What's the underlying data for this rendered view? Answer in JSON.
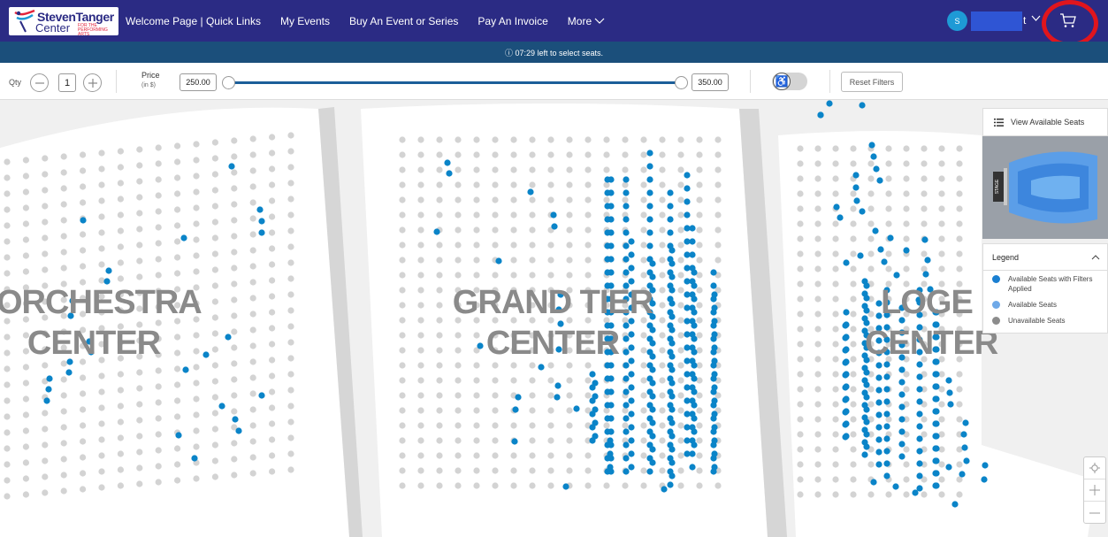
{
  "brand": {
    "line1": "StevenTanger",
    "line2": "Center",
    "tagline": "FOR THE PERFORMING ARTS"
  },
  "nav": {
    "items": [
      {
        "label": "Welcome Page | Quick Links"
      },
      {
        "label": "My Events"
      },
      {
        "label": "Buy An Event or Series"
      },
      {
        "label": "Pay An Invoice"
      },
      {
        "label": "More"
      }
    ]
  },
  "user": {
    "avatar_initial": "S",
    "name_suffix": "t"
  },
  "timer": {
    "text": "ⓘ 07:29 left to select seats."
  },
  "filters": {
    "qty_label": "Qty",
    "qty_value": "1",
    "price_label": "Price",
    "price_unit": "(in $)",
    "price_min": "250.00",
    "price_max": "350.00",
    "reset_label": "Reset Filters"
  },
  "map": {
    "sections": [
      {
        "label": "ORCHESTRA CENTER"
      },
      {
        "label": "GRAND TIER CENTER"
      },
      {
        "label": "LOGE CENTER"
      }
    ],
    "view_available_label": "View Available Seats",
    "stage_label": "STAGE"
  },
  "legend": {
    "title": "Legend",
    "items": [
      {
        "label": "Available Seats with Filters Applied",
        "color": "#1a7fd1"
      },
      {
        "label": "Available Seats",
        "color": "#6fa9e8"
      },
      {
        "label": "Unavailable Seats",
        "color": "#8c8c8c"
      }
    ]
  },
  "colors": {
    "nav_bg": "#2b2b84",
    "timer_bg": "#1b4f7b",
    "seat_available_filtered": "#0a84c8",
    "seat_unavailable": "#d3d3d3",
    "cart_highlight": "#e0151d"
  }
}
